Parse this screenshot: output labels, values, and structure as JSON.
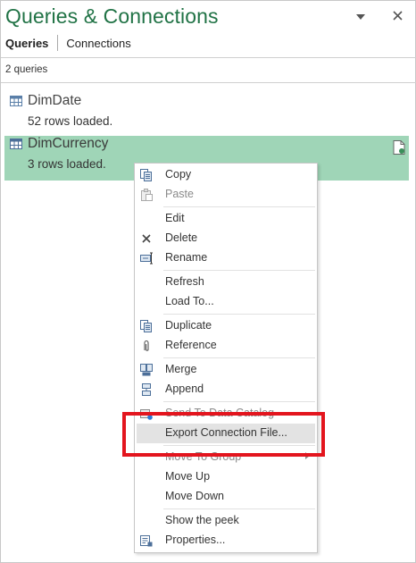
{
  "pane": {
    "title": "Queries & Connections",
    "tabs": [
      {
        "label": "Queries",
        "active": true
      },
      {
        "label": "Connections",
        "active": false
      }
    ],
    "query_count": "2 queries",
    "queries": [
      {
        "name": "DimDate",
        "status": "52 rows loaded.",
        "selected": false,
        "icon": "table-icon"
      },
      {
        "name": "DimCurrency",
        "status": "3 rows loaded.",
        "selected": true,
        "icon": "table-icon"
      }
    ]
  },
  "context_menu": {
    "items": [
      {
        "label": "Copy",
        "icon": "copy-icon",
        "enabled": true
      },
      {
        "label": "Paste",
        "icon": "paste-icon",
        "enabled": false
      },
      {
        "label": "Edit",
        "enabled": true
      },
      {
        "label": "Delete",
        "icon": "delete-icon",
        "enabled": true
      },
      {
        "label": "Rename",
        "icon": "rename-icon",
        "enabled": true
      },
      {
        "label": "Refresh",
        "enabled": true
      },
      {
        "label": "Load To...",
        "enabled": true
      },
      {
        "label": "Duplicate",
        "icon": "duplicate-icon",
        "enabled": true
      },
      {
        "label": "Reference",
        "icon": "paperclip-icon",
        "enabled": true
      },
      {
        "label": "Merge",
        "icon": "merge-icon",
        "enabled": true
      },
      {
        "label": "Append",
        "icon": "append-icon",
        "enabled": true
      },
      {
        "label": "Send To Data Catalog",
        "icon": "send-catalog-icon",
        "enabled": false
      },
      {
        "label": "Export Connection File...",
        "enabled": true,
        "highlighted": true
      },
      {
        "label": "Move To Group",
        "enabled": false,
        "submenu": true
      },
      {
        "label": "Move Up",
        "enabled": true
      },
      {
        "label": "Move Down",
        "enabled": true
      },
      {
        "label": "Show the peek",
        "enabled": true
      },
      {
        "label": "Properties...",
        "icon": "properties-icon",
        "enabled": true
      }
    ]
  },
  "colors": {
    "accent": "#217346",
    "selected_row": "#9fd5b7",
    "highlight_box": "#e3151e"
  }
}
